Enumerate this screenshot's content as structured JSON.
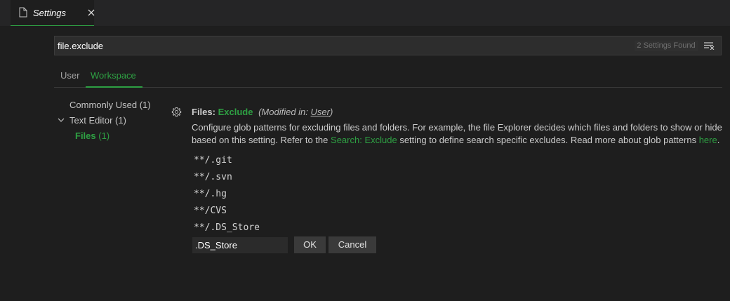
{
  "tab": {
    "label": "Settings"
  },
  "search": {
    "value": "file.exclude",
    "results": "2 Settings Found"
  },
  "scope_tabs": {
    "user": "User",
    "workspace": "Workspace"
  },
  "toc": {
    "commonly_used": "Commonly Used (1)",
    "text_editor": "Text Editor (1)",
    "files": "Files",
    "files_count": "(1)"
  },
  "setting": {
    "category": "Files:",
    "key": "Exclude",
    "modified_prefix": "(Modified in:",
    "modified_link": "User",
    "modified_suffix": ")",
    "desc_part1": "Configure glob patterns for excluding files and folders. For example, the file Explorer decides which files and folders to show or hide based on this setting. Refer to the",
    "desc_link1": "Search: Exclude",
    "desc_part2": "setting to define search specific excludes. Read more about glob patterns",
    "desc_link2": "here",
    "desc_end": "."
  },
  "patterns": [
    "**/.git",
    "**/.svn",
    "**/.hg",
    "**/CVS",
    "**/.DS_Store"
  ],
  "editor": {
    "value": ".DS_Store",
    "ok": "OK",
    "cancel": "Cancel"
  },
  "colors": {
    "accent": "#2ea043",
    "background": "#1e1e1e"
  }
}
